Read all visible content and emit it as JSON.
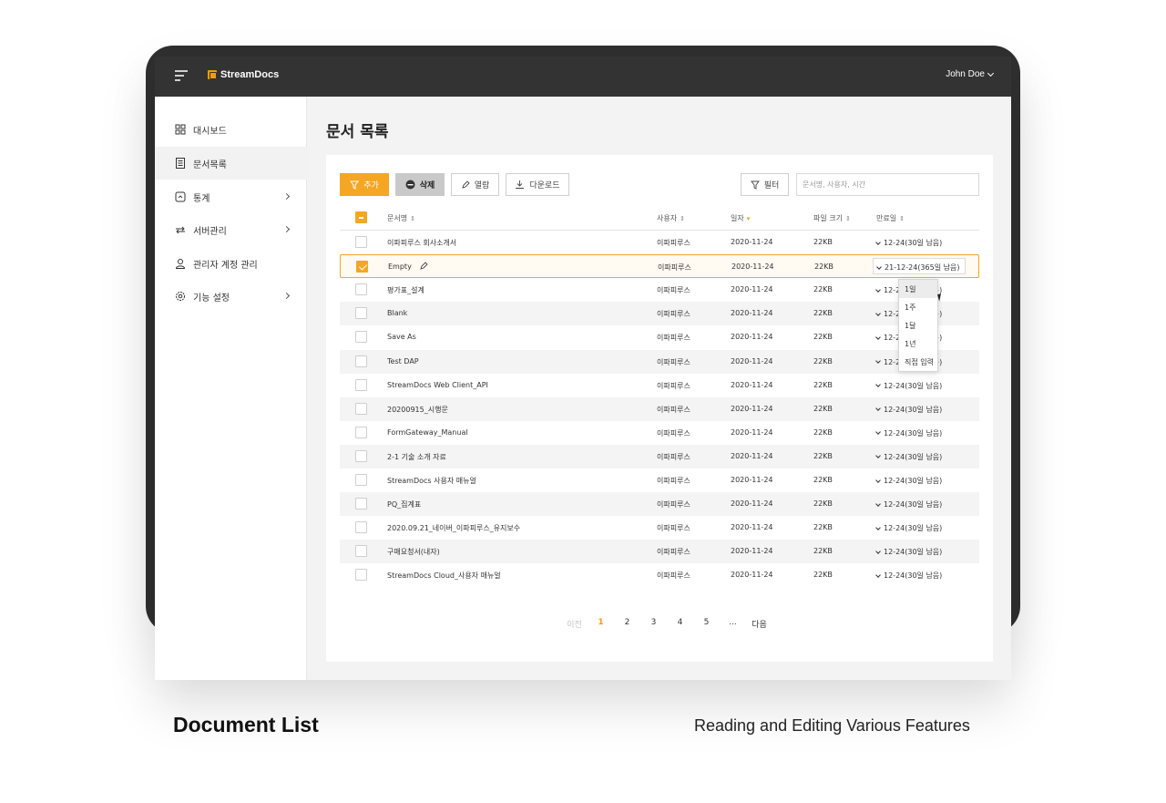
{
  "app": {
    "name": "StreamDocs",
    "brand_color": "#f5a623"
  },
  "header": {
    "user_name": "John Doe"
  },
  "sidebar": {
    "items": [
      {
        "label": "대시보드",
        "icon": "dashboard-icon",
        "arrow": false
      },
      {
        "label": "문서목록",
        "icon": "document-icon",
        "arrow": false,
        "active": true
      },
      {
        "label": "통계",
        "icon": "stats-icon",
        "arrow": true
      },
      {
        "label": "서버관리",
        "icon": "server-icon",
        "arrow": true
      },
      {
        "label": "관리자 계정 관리",
        "icon": "user-icon",
        "arrow": false
      },
      {
        "label": "기능 설정",
        "icon": "gear-icon",
        "arrow": true
      }
    ]
  },
  "main": {
    "title": "문서 목록"
  },
  "toolbar": {
    "add_label": "추가",
    "delete_label": "삭제",
    "view_label": "열람",
    "download_label": "다운로드",
    "filter_label": "필터",
    "search_placeholder": "문서명, 사용자, 시간"
  },
  "table": {
    "headers": {
      "name": "문서명",
      "user": "사용자",
      "date": "일자",
      "size": "파일 크기",
      "expiry": "만료일"
    },
    "rows": [
      {
        "name": "이파피루스 회사소개서",
        "user": "이파피루스",
        "date": "2020-11-24",
        "size": "22KB",
        "expiry": "12-24(30일 남음)"
      },
      {
        "name": "Empty",
        "user": "이파피루스",
        "date": "2020-11-24",
        "size": "22KB",
        "expiry": "21-12-24(365일 남음)"
      },
      {
        "name": "평가표_설계",
        "user": "이파피루스",
        "date": "2020-11-24",
        "size": "22KB",
        "expiry": "12-24(30일 남음)"
      },
      {
        "name": "Blank",
        "user": "이파피루스",
        "date": "2020-11-24",
        "size": "22KB",
        "expiry": "12-24(30일 남음)"
      },
      {
        "name": "Save As",
        "user": "이파피루스",
        "date": "2020-11-24",
        "size": "22KB",
        "expiry": "12-24(30일 남음)"
      },
      {
        "name": "Test DAP",
        "user": "이파피루스",
        "date": "2020-11-24",
        "size": "22KB",
        "expiry": "12-24(30일 남음)"
      },
      {
        "name": "StreamDocs Web Client_API",
        "user": "이파피루스",
        "date": "2020-11-24",
        "size": "22KB",
        "expiry": "12-24(30일 남음)"
      },
      {
        "name": "20200915_시행문",
        "user": "이파피루스",
        "date": "2020-11-24",
        "size": "22KB",
        "expiry": "12-24(30일 남음)"
      },
      {
        "name": "FormGateway_Manual",
        "user": "이파피루스",
        "date": "2020-11-24",
        "size": "22KB",
        "expiry": "12-24(30일 남음)"
      },
      {
        "name": "2-1 기술 소개 자료",
        "user": "이파피루스",
        "date": "2020-11-24",
        "size": "22KB",
        "expiry": "12-24(30일 남음)"
      },
      {
        "name": "StreamDocs 사용자 매뉴얼",
        "user": "이파피루스",
        "date": "2020-11-24",
        "size": "22KB",
        "expiry": "12-24(30일 남음)"
      },
      {
        "name": "PQ_집계표",
        "user": "이파피루스",
        "date": "2020-11-24",
        "size": "22KB",
        "expiry": "12-24(30일 남음)"
      },
      {
        "name": "2020.09.21_네이버_이파피루스_유지보수",
        "user": "이파피루스",
        "date": "2020-11-24",
        "size": "22KB",
        "expiry": "12-24(30일 남음)"
      },
      {
        "name": "구매요청서(내자)",
        "user": "이파피루스",
        "date": "2020-11-24",
        "size": "22KB",
        "expiry": "12-24(30일 남음)"
      },
      {
        "name": "StreamDocs Cloud_사용자 매뉴얼",
        "user": "이파피루스",
        "date": "2020-11-24",
        "size": "22KB",
        "expiry": "12-24(30일 남음)"
      }
    ]
  },
  "expiry_dropdown": {
    "options": [
      "1일",
      "1주",
      "1달",
      "1년",
      "직접 입력"
    ]
  },
  "pagination": {
    "prev": "이전",
    "pages": [
      "1",
      "2",
      "3",
      "4",
      "5"
    ],
    "ellipsis": "...",
    "next": "다음",
    "current": "1"
  },
  "captions": {
    "left": "Document List",
    "right": "Reading and Editing Various Features"
  }
}
